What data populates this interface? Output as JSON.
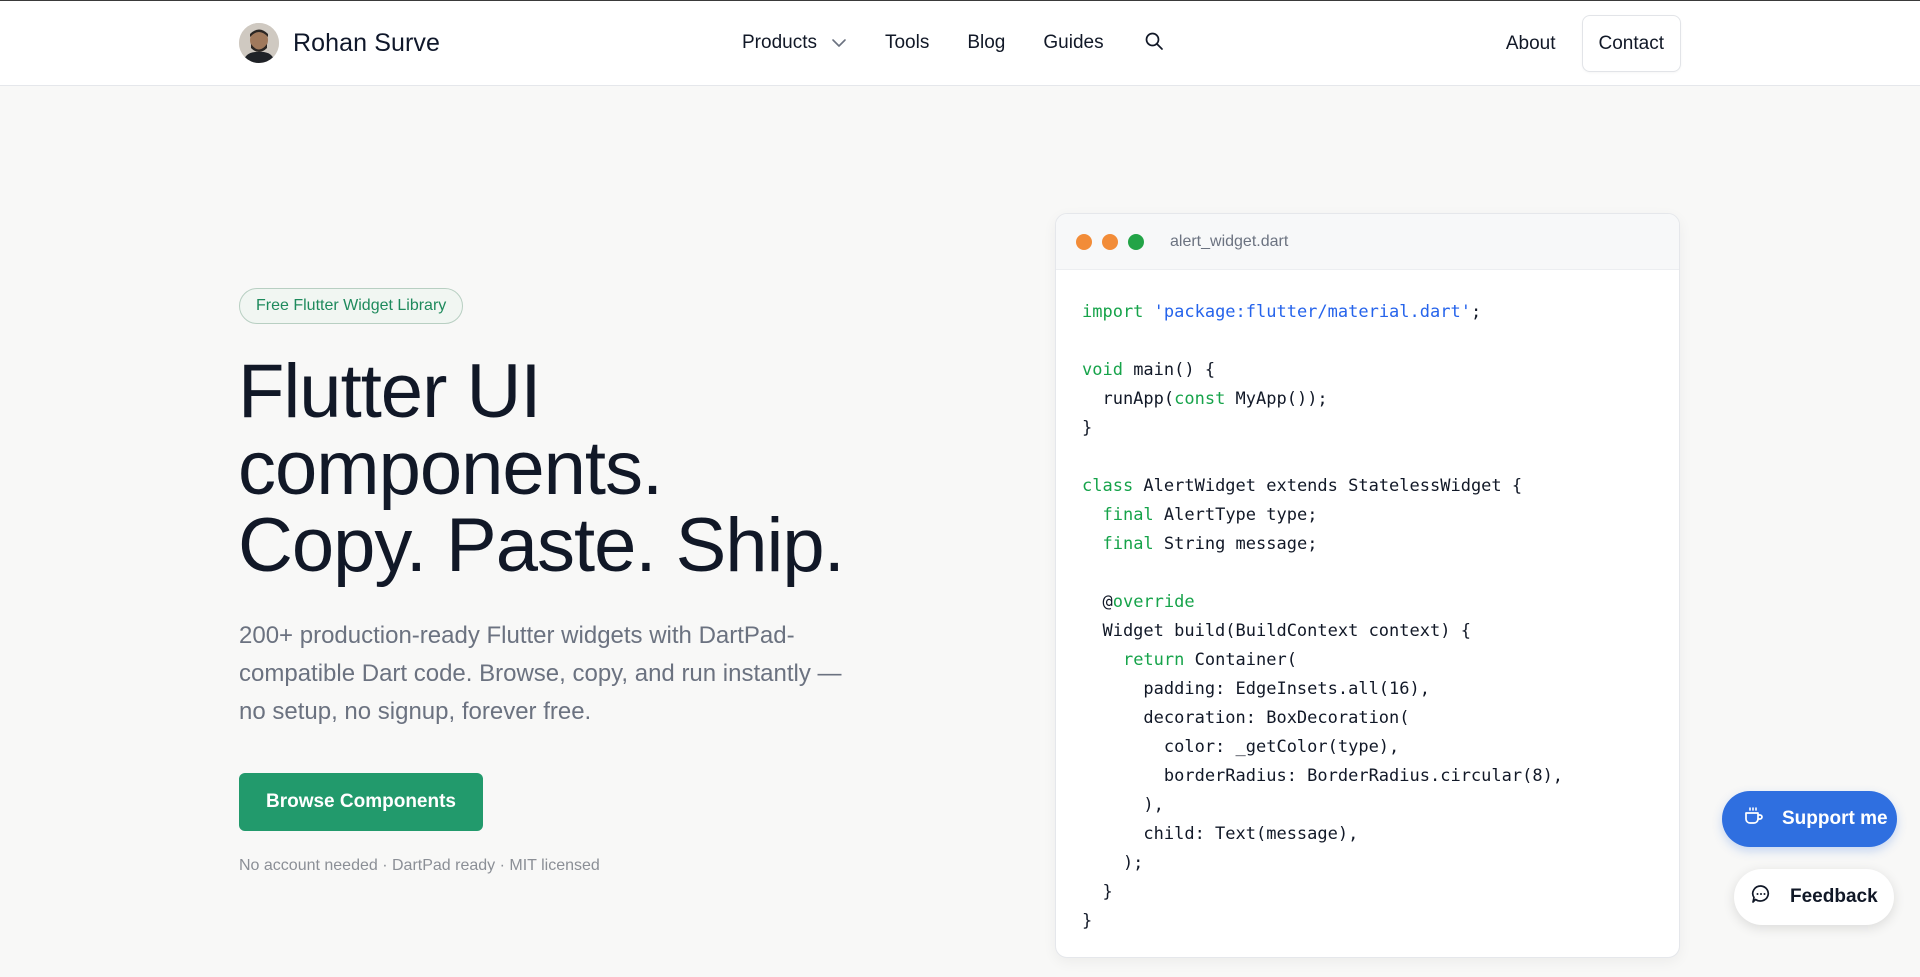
{
  "header": {
    "brand_name": "Rohan Surve",
    "nav": {
      "products": "Products",
      "tools": "Tools",
      "blog": "Blog",
      "guides": "Guides"
    },
    "about": "About",
    "contact": "Contact"
  },
  "hero": {
    "badge": "Free Flutter Widget Library",
    "headline": [
      "Flutter UI",
      "components.",
      "Copy. Paste. Ship."
    ],
    "subtext": "200+ production-ready Flutter widgets with DartPad-compatible Dart code. Browse, copy, and run instantly — no setup, no signup, forever free.",
    "cta": "Browse Components",
    "note": "No account needed · DartPad ready · MIT licensed"
  },
  "code_card": {
    "filename": "alert_widget.dart",
    "window_dots": [
      "#f28c38",
      "#f28c38",
      "#22a447"
    ],
    "lines": [
      [
        {
          "t": "import ",
          "c": "kw"
        },
        {
          "t": "'package:flutter/material.dart'",
          "c": "str"
        },
        {
          "t": ";"
        }
      ],
      [],
      [
        {
          "t": "void",
          "c": "kw"
        },
        {
          "t": " main() {"
        }
      ],
      [
        {
          "t": "  runApp("
        },
        {
          "t": "const",
          "c": "kw"
        },
        {
          "t": " MyApp());"
        }
      ],
      [
        {
          "t": "}"
        }
      ],
      [],
      [
        {
          "t": "class",
          "c": "kw"
        },
        {
          "t": " AlertWidget extends StatelessWidget {"
        }
      ],
      [
        {
          "t": "  "
        },
        {
          "t": "final",
          "c": "kw"
        },
        {
          "t": " AlertType type;"
        }
      ],
      [
        {
          "t": "  "
        },
        {
          "t": "final",
          "c": "kw"
        },
        {
          "t": " String message;"
        }
      ],
      [],
      [
        {
          "t": "  @"
        },
        {
          "t": "override",
          "c": "kw"
        }
      ],
      [
        {
          "t": "  Widget build(BuildContext context) {"
        }
      ],
      [
        {
          "t": "    "
        },
        {
          "t": "return",
          "c": "kw"
        },
        {
          "t": " Container("
        }
      ],
      [
        {
          "t": "      padding: EdgeInsets.all(16),"
        }
      ],
      [
        {
          "t": "      decoration: BoxDecoration("
        }
      ],
      [
        {
          "t": "        color: _getColor(type),"
        }
      ],
      [
        {
          "t": "        borderRadius: BorderRadius.circular(8),"
        }
      ],
      [
        {
          "t": "      ),"
        }
      ],
      [
        {
          "t": "      child: Text(message),"
        }
      ],
      [
        {
          "t": "    );"
        }
      ],
      [
        {
          "t": "  }"
        }
      ],
      [
        {
          "t": "}"
        }
      ]
    ]
  },
  "floating": {
    "support": "Support me",
    "feedback": "Feedback"
  },
  "colors": {
    "accent_green": "#229a6c",
    "support_blue": "#2f6fe0",
    "keyword": "#16a34a",
    "string": "#2563eb"
  },
  "icons": {
    "avatar": "avatar",
    "products_chevron": "chevron-down-icon",
    "search": "search-icon",
    "support": "coffee-cup-icon",
    "feedback": "chat-bubble-icon"
  }
}
